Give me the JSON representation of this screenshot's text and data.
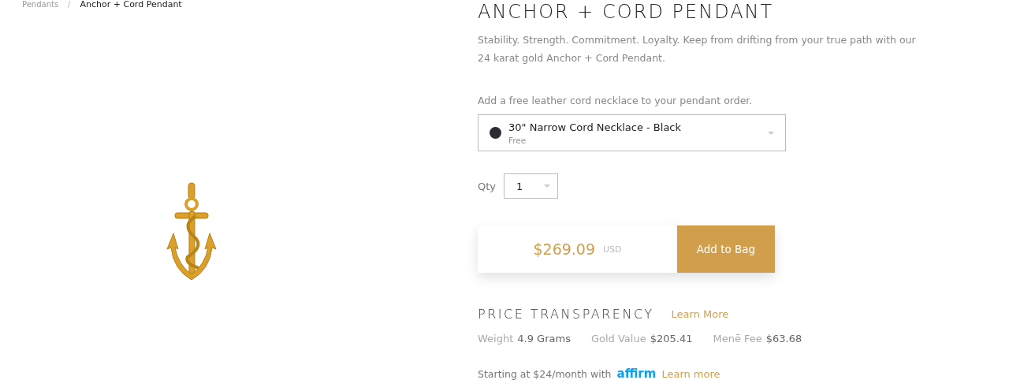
{
  "breadcrumb_separator": "/",
  "breadcrumb": [
    {
      "label": "Pendants",
      "current": false
    },
    {
      "label": "Anchor + Cord Pendant",
      "current": true
    }
  ],
  "product": {
    "title": "ANCHOR + CORD PENDANT",
    "description": "Stability. Strength. Commitment. Loyalty. Keep from drifting from your true path with our 24 karat gold Anchor + Cord Pendant."
  },
  "cord_option": {
    "prompt": "Add a free leather cord necklace to your pendant order.",
    "value": "30\" Narrow Cord Necklace - Black",
    "subtext": "Free",
    "color": "#2b2d33"
  },
  "quantity": {
    "label": "Qty",
    "value": "1"
  },
  "purchase": {
    "price": "$269.09",
    "currency": "USD",
    "button": "Add to Bag"
  },
  "price_transparency": {
    "title": "PRICE TRANSPARENCY",
    "link": "Learn More",
    "stats": [
      {
        "label": "Weight",
        "value": "4.9 Grams"
      },
      {
        "label": "Gold Value",
        "value": "$205.41"
      },
      {
        "label": "Menē Fee",
        "value": "$63.68"
      }
    ]
  },
  "financing": {
    "text": "Starting at $24/month with",
    "logo": "affirm",
    "link": "Learn more"
  }
}
